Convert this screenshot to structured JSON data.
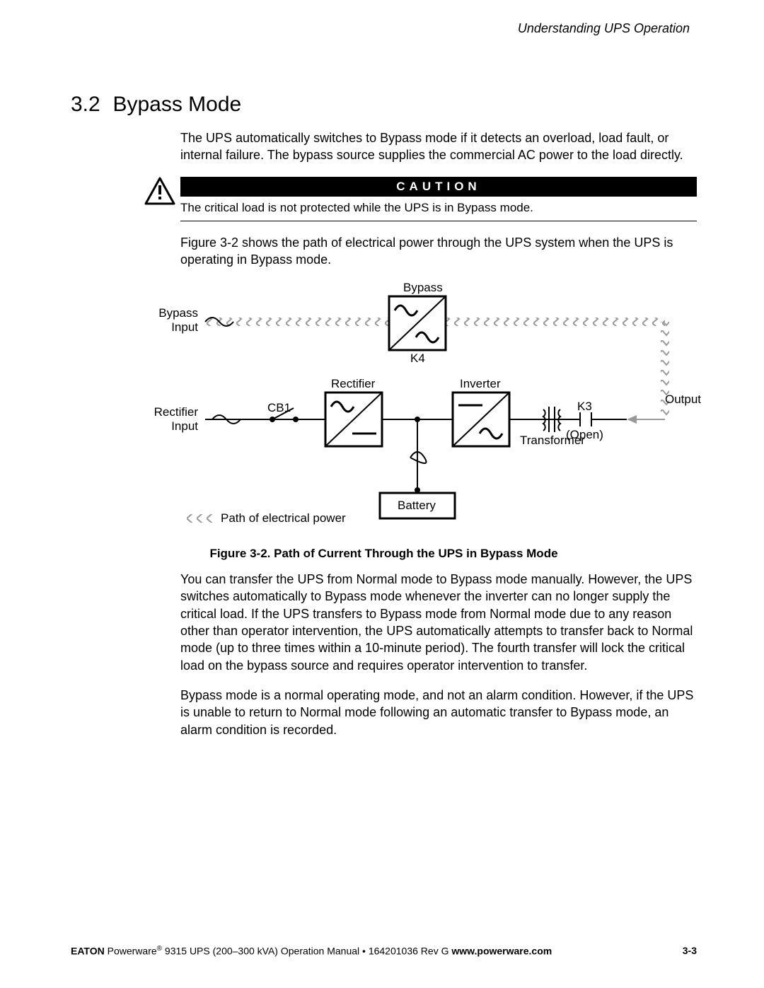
{
  "running_head": "Understanding UPS Operation",
  "section": {
    "number": "3.2",
    "title": "Bypass Mode"
  },
  "paras": {
    "intro": "The UPS automatically switches to Bypass mode if it detects an overload, load fault, or internal failure. The bypass source supplies the commercial AC power to the load directly.",
    "fig_ref": "Figure 3-2 shows the path of electrical power through the UPS system when the UPS is operating in Bypass mode.",
    "after1": "You can transfer the UPS from Normal mode to Bypass mode manually. However, the UPS switches automatically to Bypass mode whenever the inverter can no longer supply the critical load. If the UPS transfers to Bypass mode from Normal mode due to any reason other than operator intervention, the UPS automatically attempts to transfer back to Normal mode (up to three times within a 10-minute period). The fourth transfer will lock the critical load on the bypass source and requires operator intervention to transfer.",
    "after2": "Bypass mode is a normal operating mode, and not an alarm condition. However, if the UPS is unable to return to Normal mode following an automatic transfer to Bypass mode, an alarm condition is recorded."
  },
  "caution": {
    "label": "CAUTION",
    "text": "The critical load is not protected while the UPS is in Bypass mode."
  },
  "figure": {
    "caption": "Figure 3-2. Path of Current Through the UPS in Bypass Mode",
    "labels": {
      "bypass_input": "Bypass\nInput",
      "rectifier_input": "Rectifier\nInput",
      "cb1": "CB1",
      "rectifier": "Rectifier",
      "bypass": "Bypass",
      "k4": "K4",
      "inverter": "Inverter",
      "transformer": "Transformer",
      "k3": "K3",
      "k3_state": "(Open)",
      "output": "Output",
      "battery": "Battery",
      "legend": "Path of electrical power"
    }
  },
  "footer": {
    "brand": "EATON",
    "product": " Powerware",
    "reg": "®",
    "rest": " 9315 UPS (200–300 kVA) Operation Manual  •  164201036 Rev G  ",
    "url": "www.powerware.com",
    "page": "3-3"
  }
}
